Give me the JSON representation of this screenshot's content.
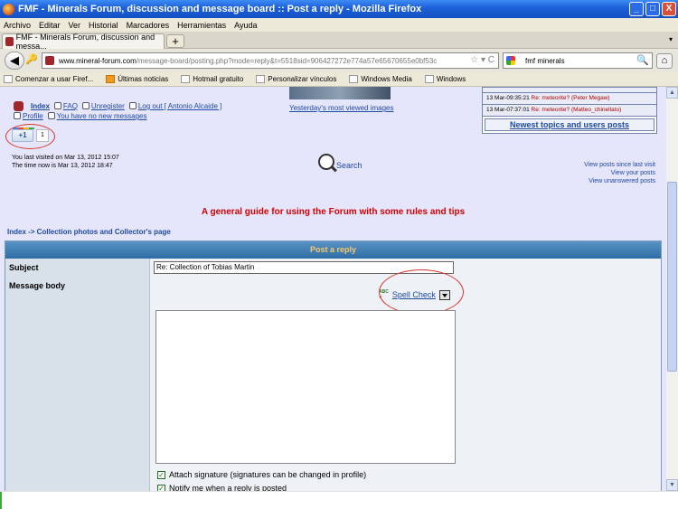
{
  "window": {
    "title": "FMF - Minerals Forum, discussion and message board :: Post a reply - Mozilla Firefox",
    "btn_min": "_",
    "btn_max": "□",
    "btn_close": "X"
  },
  "menu": [
    "Archivo",
    "Editar",
    "Ver",
    "Historial",
    "Marcadores",
    "Herramientas",
    "Ayuda"
  ],
  "tabs": {
    "active": "FMF - Minerals Forum, discussion and messa...",
    "new_tab": "+",
    "overflow": "▾"
  },
  "nav": {
    "url_domain": "www.mineral-forum.com",
    "url_path": "/message-board/posting.php?mode=reply&t=5518sid=906427272e774a57e65670655e0bf53c",
    "search_value": "fmf minerals",
    "back": "◀",
    "home": "⌂"
  },
  "bookmarks": [
    "Comenzar a usar Firef...",
    "Últimas noticias",
    "Hotmail gratuito",
    "Personalizar vínculos",
    "Windows Media",
    "Windows"
  ],
  "forum": {
    "index": "Index",
    "faq": "FAQ",
    "unregister": "Unregister",
    "logout": "Log out [ Antonio Alcaide ]",
    "profile": "Profile",
    "messages": "You have no new messages",
    "viewed": "Yesterday's most viewed images",
    "plusone": "+1",
    "plus_count": "1",
    "last_visit": "You last visited on Mar 13, 2012 15:07",
    "time_now": "The time now is Mar 13, 2012 18:47",
    "search": "Search",
    "links": [
      "View posts since last visit",
      "View your posts",
      "View unanswered posts"
    ],
    "topics": [
      {
        "time": "13 Mar-09:35:21",
        "title": "Re: meteorite? (Peter Megaw)"
      },
      {
        "time": "13 Mar-07:37:01",
        "title": "Re: meteorite? (Matteo_chinellato)"
      }
    ],
    "newest": "Newest topics and users posts",
    "guide": "A general guide for using the Forum with some rules and tips",
    "breadcrumb": "Index -> Collection photos and Collector's page"
  },
  "form": {
    "header": "Post a reply",
    "subject_label": "Subject",
    "subject_value": "Re: Collection of Tobias Martin",
    "body_label": "Message body",
    "spell_abc": "ABC",
    "spell_check": "Spell Check",
    "attach_sig": "Attach signature (signatures can be changed in profile)",
    "notify": "Notify me when a reply is posted"
  }
}
